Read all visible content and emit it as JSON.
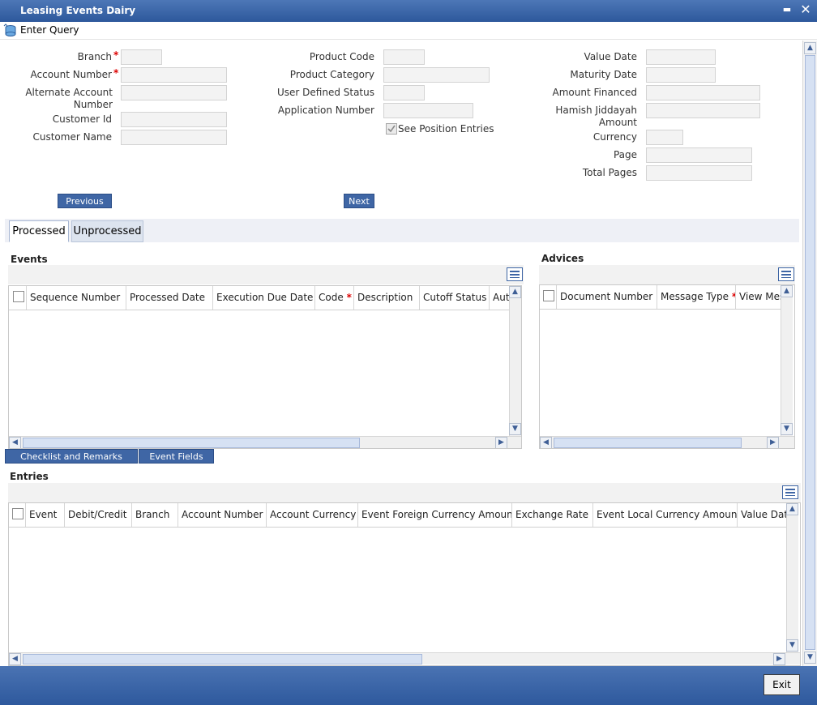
{
  "window": {
    "title": "Leasing Events Dairy",
    "minimize_symbol": "▬",
    "close_symbol": "✕"
  },
  "toolbar": {
    "enter_query_label": "Enter Query",
    "enter_query_icon": "database-query-icon"
  },
  "form": {
    "left": {
      "branch_label": "Branch",
      "account_number_label": "Account Number",
      "alternate_account_number_label_1": "Alternate Account",
      "alternate_account_number_label_2": "Number",
      "customer_id_label": "Customer Id",
      "customer_name_label": "Customer Name"
    },
    "middle": {
      "product_code_label": "Product Code",
      "product_category_label": "Product Category",
      "user_defined_status_label": "User Defined Status",
      "application_number_label": "Application Number",
      "see_position_entries_label": "See Position Entries",
      "see_position_entries_checked": true
    },
    "right": {
      "value_date_label": "Value Date",
      "maturity_date_label": "Maturity Date",
      "amount_financed_label": "Amount Financed",
      "hamish_label_1": "Hamish Jiddayah",
      "hamish_label_2": "Amount",
      "currency_label": "Currency",
      "page_label": "Page",
      "total_pages_label": "Total Pages"
    },
    "required_marker": "*"
  },
  "nav": {
    "previous_label": "Previous",
    "next_label": "Next"
  },
  "tabs": [
    {
      "label": "Processed",
      "active": true
    },
    {
      "label": "Unprocessed",
      "active": false
    }
  ],
  "events": {
    "title": "Events",
    "columns": [
      "Sequence Number",
      "Processed Date",
      "Execution Due Date",
      "Code",
      "Description",
      "Cutoff Status",
      "Aut"
    ],
    "required_columns": [
      "Execution Due Date",
      "Code"
    ],
    "rows": []
  },
  "advices": {
    "title": "Advices",
    "columns": [
      "Document Number",
      "Message Type",
      "View Mes"
    ],
    "required_columns": [
      "Message Type"
    ],
    "rows": []
  },
  "actions": {
    "checklist_label": "Checklist and Remarks",
    "event_fields_label": "Event Fields"
  },
  "entries": {
    "title": "Entries",
    "columns": [
      "Event",
      "Debit/Credit",
      "Branch",
      "Account Number",
      "Account Currency",
      "Event Foreign Currency Amount",
      "Exchange Rate",
      "Event Local Currency Amount",
      "Value Date"
    ],
    "rows": []
  },
  "footer": {
    "exit_label": "Exit"
  },
  "colors": {
    "titlebar": "#3a64a8",
    "button": "#3f66a5",
    "required": "#dd0000",
    "field": "#f3f3f3"
  }
}
